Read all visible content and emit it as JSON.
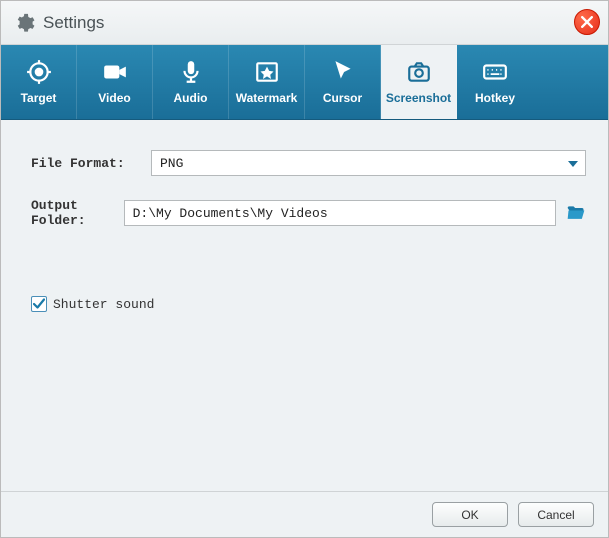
{
  "window": {
    "title": "Settings"
  },
  "tabs": [
    {
      "label": "Target"
    },
    {
      "label": "Video"
    },
    {
      "label": "Audio"
    },
    {
      "label": "Watermark"
    },
    {
      "label": "Cursor"
    },
    {
      "label": "Screenshot"
    },
    {
      "label": "Hotkey"
    }
  ],
  "form": {
    "file_format_label": "File Format:",
    "file_format_value": "PNG",
    "output_folder_label": "Output Folder:",
    "output_folder_value": "D:\\My Documents\\My Videos"
  },
  "checkbox": {
    "shutter_label": "Shutter sound",
    "shutter_checked": true
  },
  "buttons": {
    "ok": "OK",
    "cancel": "Cancel"
  },
  "colors": {
    "accent": "#1a6e98",
    "close": "#e62e1a"
  }
}
